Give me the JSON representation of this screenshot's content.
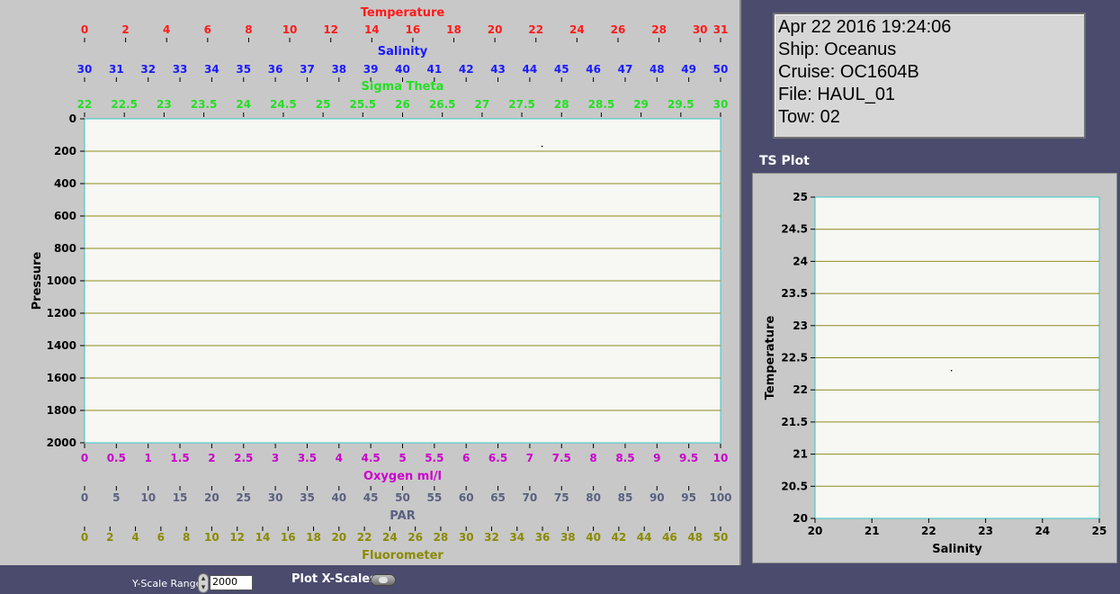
{
  "info": {
    "lines": [
      "Apr 22 2016 19:24:06",
      "Ship: Oceanus",
      "Cruise: OC1604B",
      "File: HAUL_01",
      "Tow: 02"
    ]
  },
  "ts_plot": {
    "title": "TS Plot"
  },
  "controls": {
    "yscale_label": "Y-Scale Range",
    "yscale_value": "2000",
    "plot_xscales_label": "Plot X-Scales"
  },
  "colors": {
    "temperature": "#ff1a1a",
    "salinity": "#1a1aff",
    "sigma": "#22e022",
    "oxygen": "#cc00cc",
    "par": "#5a6080",
    "fluorometer": "#8a8a00",
    "grid": "#8c8c1e",
    "plot_bg": "#f7f7f4"
  },
  "chart_data": [
    {
      "type": "line",
      "name": "profile-plot",
      "ylabel": "Pressure",
      "ylim": [
        0,
        2000
      ],
      "y_ticks": [
        0,
        200,
        400,
        600,
        800,
        1000,
        1200,
        1400,
        1600,
        1800,
        2000
      ],
      "top_axes": [
        {
          "label": "Temperature",
          "color": "#ff1a1a",
          "min": 0,
          "max": 31,
          "ticks": [
            0,
            2,
            4,
            6,
            8,
            10,
            12,
            14,
            16,
            18,
            20,
            22,
            24,
            26,
            28,
            30,
            31
          ]
        },
        {
          "label": "Salinity",
          "color": "#1a1aff",
          "min": 30,
          "max": 50,
          "ticks": [
            30,
            31,
            32,
            33,
            34,
            35,
            36,
            37,
            38,
            39,
            40,
            41,
            42,
            43,
            44,
            45,
            46,
            47,
            48,
            49,
            50
          ]
        },
        {
          "label": "Sigma Theta",
          "color": "#22e022",
          "min": 22,
          "max": 30,
          "ticks": [
            22,
            22.5,
            23,
            23.5,
            24,
            24.5,
            25,
            25.5,
            26,
            26.5,
            27,
            27.5,
            28,
            28.5,
            29,
            29.5,
            30
          ]
        }
      ],
      "bottom_axes": [
        {
          "label": "Oxygen ml/l",
          "color": "#cc00cc",
          "min": 0,
          "max": 10,
          "ticks": [
            0,
            0.5,
            1,
            1.5,
            2,
            2.5,
            3,
            3.5,
            4,
            4.5,
            5,
            5.5,
            6,
            6.5,
            7,
            7.5,
            8,
            8.5,
            9,
            9.5,
            10
          ]
        },
        {
          "label": "PAR",
          "color": "#5a6080",
          "min": 0,
          "max": 100,
          "ticks": [
            0,
            5,
            10,
            15,
            20,
            25,
            30,
            35,
            40,
            45,
            50,
            55,
            60,
            65,
            70,
            75,
            80,
            85,
            90,
            95,
            100
          ]
        },
        {
          "label": "Fluorometer",
          "color": "#8a8a00",
          "min": 0,
          "max": 50,
          "ticks": [
            0,
            2,
            4,
            6,
            8,
            10,
            12,
            14,
            16,
            18,
            20,
            22,
            24,
            26,
            28,
            30,
            32,
            34,
            36,
            38,
            40,
            42,
            44,
            46,
            48,
            50
          ]
        }
      ],
      "grid": true,
      "points": [
        {
          "x": 22.3,
          "x_axis": "Temperature",
          "y": 170
        }
      ]
    },
    {
      "type": "scatter",
      "name": "ts-plot",
      "title": "TS Plot",
      "xlabel": "Salinity",
      "ylabel": "Temperature",
      "xlim": [
        20,
        25
      ],
      "ylim": [
        20,
        25
      ],
      "x_ticks": [
        20,
        21,
        22,
        23,
        24,
        25
      ],
      "y_ticks": [
        20,
        20.5,
        21,
        21.5,
        22,
        22.5,
        23,
        23.5,
        24,
        24.5,
        25
      ],
      "grid": true,
      "points": [
        {
          "x": 22.4,
          "y": 22.3
        }
      ]
    }
  ]
}
